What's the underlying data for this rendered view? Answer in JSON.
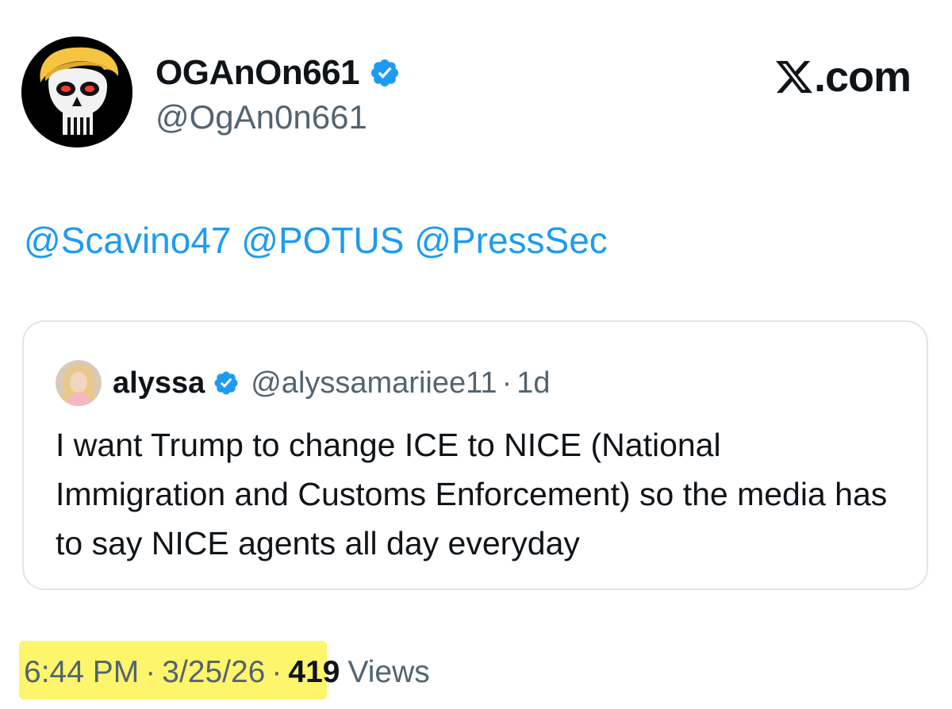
{
  "post": {
    "author": {
      "display_name": "OGAnOn661",
      "handle": "@OgAn0n661",
      "verified_icon": "verified-badge-icon"
    },
    "brand": {
      "label": ".com",
      "icon": "x-logo-icon"
    },
    "mentions": [
      "@Scavino47",
      "@POTUS",
      "@PressSec"
    ],
    "quote": {
      "display_name": "alyssa",
      "handle": "@alyssamariiee11",
      "separator": "·",
      "age": "1d",
      "text": "I want Trump to change ICE to NICE (National Immigration and Customs Enforcement) so the media has to say NICE agents all day everyday"
    },
    "footer": {
      "time": "6:44 PM",
      "separator": "·",
      "date": "3/25/26",
      "views_count": "419",
      "views_label": "Views"
    }
  },
  "colors": {
    "link": "#1d9bf0",
    "muted": "#536471",
    "text": "#0f1419",
    "verified": "#1d9bf0",
    "highlight": "#fdf56b"
  }
}
